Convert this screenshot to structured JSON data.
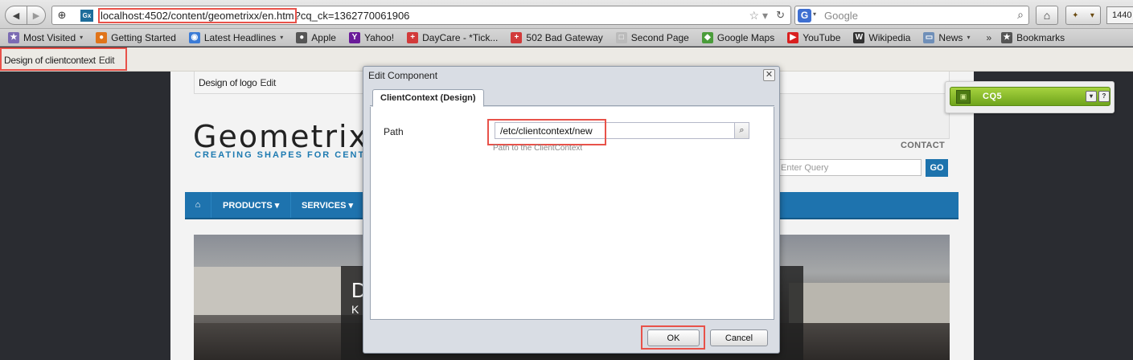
{
  "browser": {
    "url_highlighted": "localhost:4502/content/geometrixx/en.htm",
    "url_rest": "?cq_ck=1362770061906",
    "favicon_text": "Gx",
    "search_placeholder": "Google",
    "search_engine_letter": "G",
    "resolution_text": "1440"
  },
  "bookmarks": [
    {
      "label": "Most Visited",
      "icon": "most-visited-icon",
      "color": "#7b6bb3",
      "dropdown": true
    },
    {
      "label": "Getting Started",
      "icon": "firefox-icon",
      "color": "#e0741a",
      "dropdown": false
    },
    {
      "label": "Latest Headlines",
      "icon": "rss-icon",
      "color": "#3b7bd6",
      "dropdown": true
    },
    {
      "label": "Apple",
      "icon": "apple-icon",
      "color": "#555555",
      "dropdown": false
    },
    {
      "label": "Yahoo!",
      "icon": "yahoo-icon",
      "color": "#6a1b9a",
      "dropdown": false
    },
    {
      "label": "DayCare - *Tick...",
      "icon": "cross-icon",
      "color": "#d23a3a",
      "dropdown": false
    },
    {
      "label": "502 Bad Gateway",
      "icon": "cross-icon",
      "color": "#d23a3a",
      "dropdown": false
    },
    {
      "label": "Second Page",
      "icon": "page-icon",
      "color": "#bbbbbb",
      "dropdown": false
    },
    {
      "label": "Google Maps",
      "icon": "maps-icon",
      "color": "#4a9c3a",
      "dropdown": false
    },
    {
      "label": "YouTube",
      "icon": "youtube-icon",
      "color": "#d91f1f",
      "dropdown": false
    },
    {
      "label": "Wikipedia",
      "icon": "wikipedia-icon",
      "color": "#333333",
      "dropdown": false
    },
    {
      "label": "News",
      "icon": "folder-icon",
      "color": "#6f8fb8",
      "dropdown": true
    }
  ],
  "bookmarks_overflow": "»",
  "bookmarks_tail": "Bookmarks",
  "cq": {
    "design_label": "Design of clientcontext",
    "design_edit": "Edit",
    "logo_label": "Design of logo",
    "logo_edit": "Edit",
    "sidekick_title": "CQ5"
  },
  "site": {
    "brand": "Geometrixx",
    "tagline": "CREATING SHAPES FOR CENTU",
    "contact": "CONTACT",
    "search_placeholder": "Enter Query",
    "go_label": "GO",
    "nav": [
      {
        "label": "PRODUCTS ▾"
      },
      {
        "label": "SERVICES ▾"
      }
    ],
    "hero_big": "D",
    "hero_small": "K"
  },
  "dialog": {
    "title": "Edit Component",
    "tab": "ClientContext (Design)",
    "path_label": "Path",
    "path_value": "/etc/clientcontext/new",
    "path_hint": "Path to the ClientContext",
    "ok_label": "OK",
    "cancel_label": "Cancel"
  },
  "colors": {
    "highlight": "#e8524a",
    "cq_green": "#8cbf2e",
    "site_blue": "#1e73ae"
  }
}
